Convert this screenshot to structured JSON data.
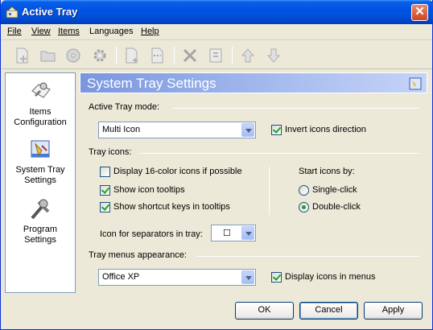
{
  "window": {
    "title": "Active Tray"
  },
  "menu": [
    "File",
    "View",
    "Items",
    "Languages",
    "Help"
  ],
  "toolbar": {
    "icons": [
      "new-item-icon",
      "open-folder-icon",
      "disk-icon",
      "gear-icon",
      "new-document-icon",
      "separator-item-icon",
      "delete-icon",
      "properties-icon",
      "move-up-icon",
      "move-down-icon"
    ]
  },
  "nav": [
    {
      "label_line1": "Items",
      "label_line2": "Configuration"
    },
    {
      "label_line1": "System Tray",
      "label_line2": "Settings"
    },
    {
      "label_line1": "Program",
      "label_line2": "Settings"
    }
  ],
  "panel": {
    "title": "System Tray Settings",
    "mode_group": "Active Tray mode:",
    "mode_value": "Multi Icon",
    "invert_label": "Invert icons direction",
    "invert_checked": true,
    "tray_icons_group": "Tray icons:",
    "opt_16color": "Display 16-color icons if possible",
    "opt_16color_checked": false,
    "opt_tooltips": "Show icon tooltips",
    "opt_tooltips_checked": true,
    "opt_shortcuts": "Show shortcut keys in tooltips",
    "opt_shortcuts_checked": true,
    "start_by_label": "Start icons by:",
    "single_click": "Single-click",
    "double_click": "Double-click",
    "start_selected": "Double-click",
    "separator_label": "Icon for separators in tray:",
    "separator_value": "☐",
    "menus_group": "Tray menus appearance:",
    "menus_value": "Office XP",
    "display_icons_label": "Display icons in menus",
    "display_icons_checked": true
  },
  "buttons": {
    "ok": "OK",
    "cancel": "Cancel",
    "apply": "Apply"
  },
  "colors": {
    "titlebar": "#0054e3",
    "panel_header": "#7a96df",
    "window_bg": "#ece9d8",
    "check": "#21a121"
  }
}
